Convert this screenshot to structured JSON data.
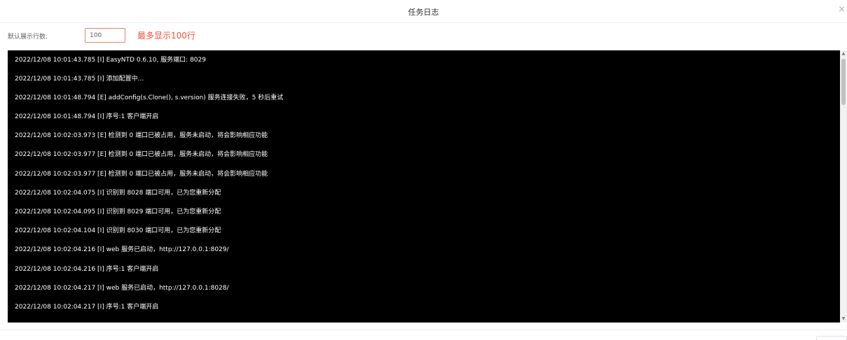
{
  "dialog": {
    "title": "任务日志",
    "close_icon": "close-icon",
    "close_glyph": "×"
  },
  "settings": {
    "row_count_label": "默认展示行数:",
    "row_count_value": "100",
    "hint": "最多显示100行"
  },
  "log": {
    "background": "#000000",
    "text_color": "#ffffff",
    "lines": [
      "2022/12/08 10:01:43.785 [I] EasyNTD 0.6.10, 服务端口: 8029",
      "2022/12/08 10:01:43.785 [I] 添加配置中...",
      "2022/12/08 10:01:48.794 [E] addConfig(s.Clone(), s.version) 服务连接失败，5 秒后重试",
      "2022/12/08 10:01:48.794 [I] 序号:1 客户端开启",
      "2022/12/08 10:02:03.973 [E] 检测到 0 端口已被占用，服务未启动，将会影响相应功能",
      "2022/12/08 10:02:03.977 [E] 检测到 0 端口已被占用，服务未启动，将会影响相应功能",
      "2022/12/08 10:02:03.977 [E] 检测到 0 端口已被占用，服务未启动，将会影响相应功能",
      "2022/12/08 10:02:04.075 [I] 识别到 8028 端口可用，已为您重新分配",
      "2022/12/08 10:02:04.095 [I] 识别到 8029 端口可用，已为您重新分配",
      "2022/12/08 10:02:04.104 [I] 识别到 8030 端口可用，已为您重新分配",
      "2022/12/08 10:02:04.216 [I] web 服务已启动，http://127.0.0.1:8029/",
      "2022/12/08 10:02:04.216 [I] 序号:1 客户端开启",
      "2022/12/08 10:02:04.217 [I] web 服务已启动，http://127.0.0.1:8028/",
      "2022/12/08 10:02:04.217 [I] 序号:1 客户端开启"
    ]
  },
  "scrollbar": {
    "up_glyph": "▲",
    "down_glyph": "▼"
  },
  "colors": {
    "hint": "#f0513b",
    "input_border": "#e8806f"
  }
}
